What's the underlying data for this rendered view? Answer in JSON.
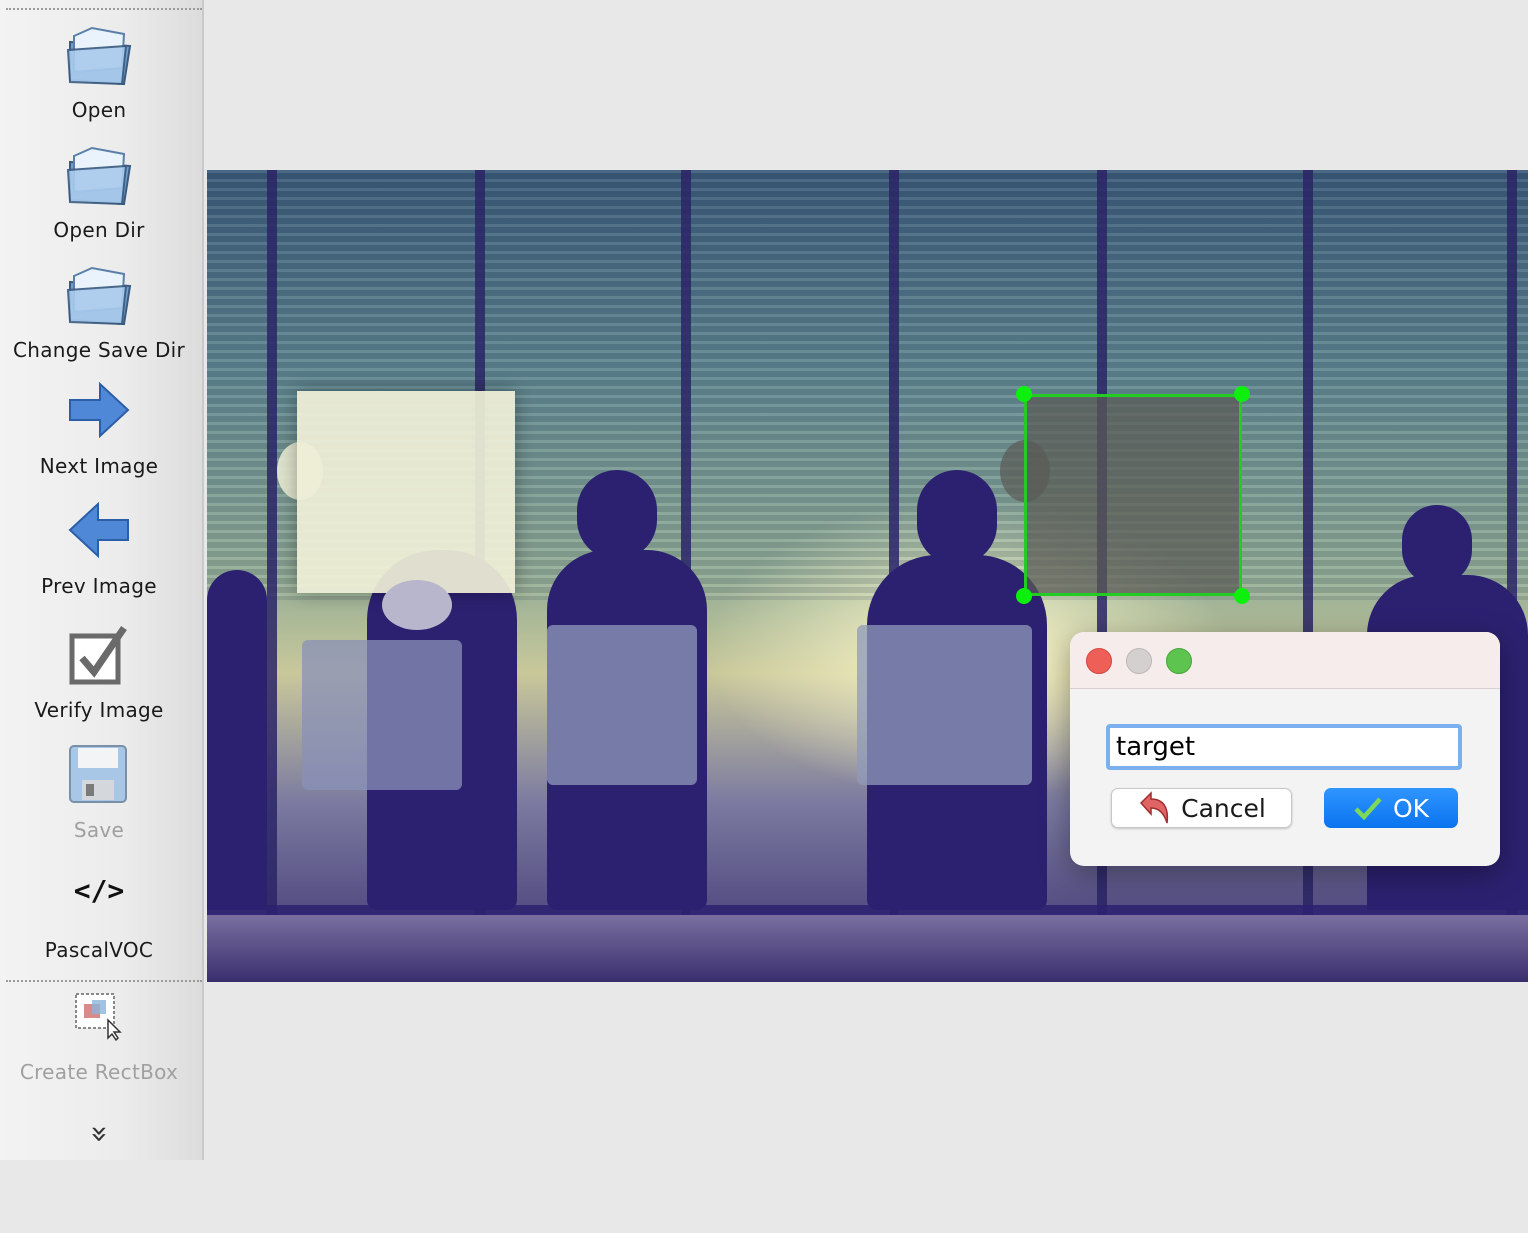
{
  "toolbar": {
    "open": "Open",
    "open_dir": "Open Dir",
    "change_save_dir": "Change Save Dir",
    "next_image": "Next Image",
    "prev_image": "Prev Image",
    "verify_image": "Verify Image",
    "save": "Save",
    "format_glyph": "</>",
    "format": "PascalVOC",
    "create_rectbox": "Create RectBox",
    "more_glyph": "»"
  },
  "dialog": {
    "input_value": "target",
    "cancel_label": "Cancel",
    "ok_label": "OK"
  },
  "colors": {
    "selection": "#22cc22",
    "handle": "#0df00d",
    "ok_button": "#0a74f0",
    "close": "#ee5f57",
    "minimize": "#d5d0d0",
    "zoom": "#5cc44f"
  },
  "icons": [
    "folder-icon",
    "arrow-right-icon",
    "arrow-left-icon",
    "checkbox-icon",
    "floppy-disk-icon",
    "code-icon",
    "rectbox-icon",
    "chevron-double-down-icon",
    "undo-arrow-icon",
    "checkmark-icon"
  ]
}
